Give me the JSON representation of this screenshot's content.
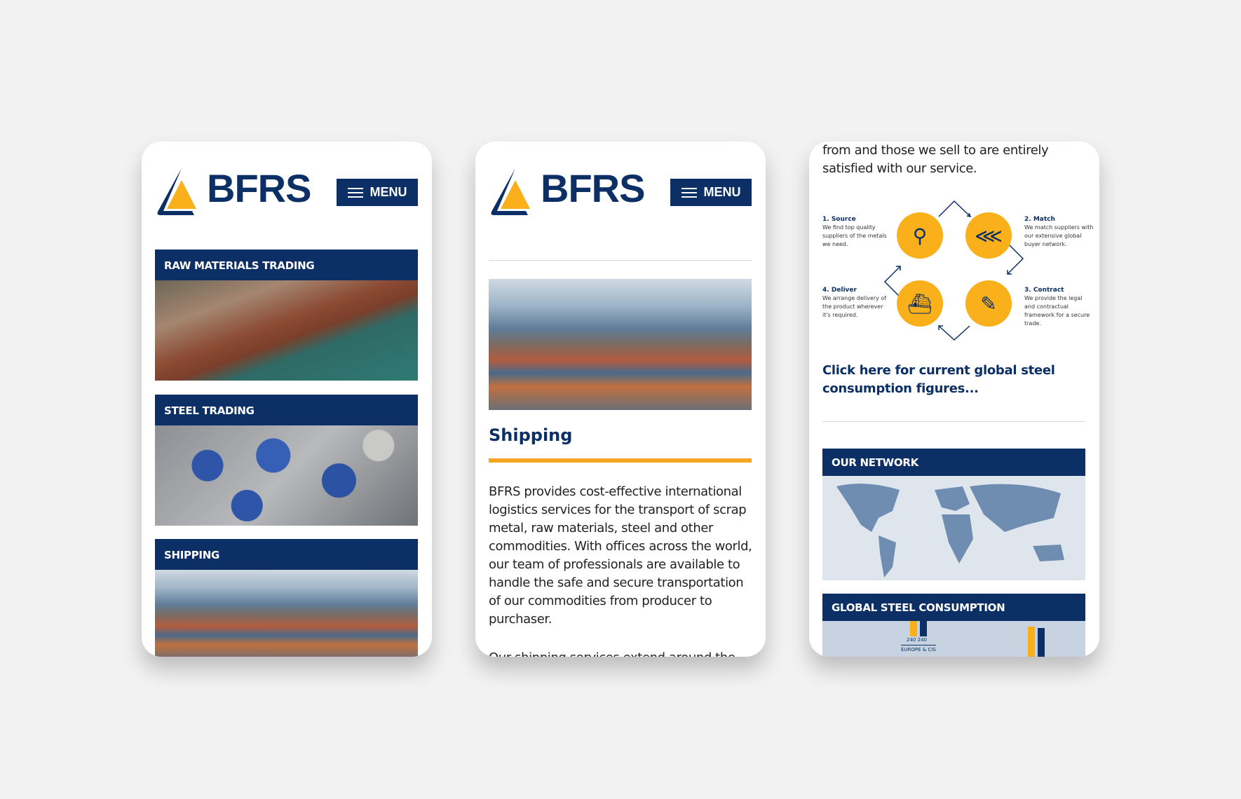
{
  "brand": {
    "name": "BFRS",
    "menu_label": "MENU",
    "colors": {
      "navy": "#0c2f66",
      "yellow": "#f9b01a"
    }
  },
  "screen1": {
    "sections": [
      {
        "label": "RAW MATERIALS TRADING"
      },
      {
        "label": "STEEL TRADING"
      },
      {
        "label": "SHIPPING"
      }
    ]
  },
  "screen2": {
    "title": "Shipping",
    "paragraph": "BFRS provides cost-effective international logistics services for the transport of scrap metal, raw materials, steel and other commodities. With offices across the world, our team of professionals are available to handle the safe and secure transportation of our commodities from producer to purchaser.",
    "paragraph2": "Our shipping services extend around the"
  },
  "screen3": {
    "intro": "from and those we sell to are entirely satisfied with our service.",
    "steps": [
      {
        "title": "1. Source",
        "text": "We find top quality suppliers of the metals we need.",
        "icon": "map-pin-icon"
      },
      {
        "title": "2. Match",
        "text": "We match suppliers with our extensive global buyer network.",
        "icon": "share-icon"
      },
      {
        "title": "3. Contract",
        "text": "We provide the legal and contractual framework for a secure trade.",
        "icon": "contract-icon"
      },
      {
        "title": "4. Deliver",
        "text": "We arrange delivery of the product wherever it's required.",
        "icon": "ship-icon"
      }
    ],
    "link": "Click here for current global steel consumption figures...",
    "network_label": "OUR NETWORK",
    "consumption_label": "GLOBAL STEEL CONSUMPTION",
    "consumption_values": [
      "240",
      "240"
    ],
    "region_label": "EUROPE & CIS"
  }
}
